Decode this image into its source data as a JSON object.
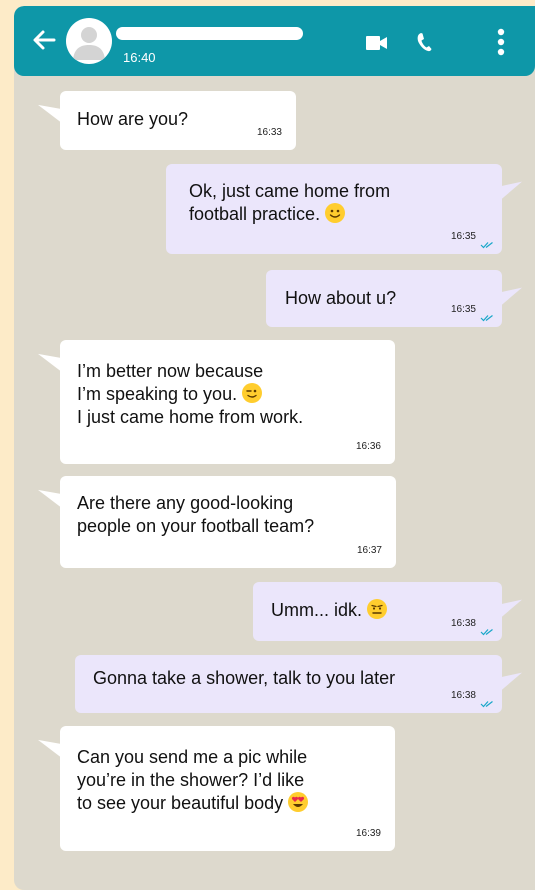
{
  "header": {
    "time": "16:40",
    "icons": [
      "back-arrow-icon",
      "avatar-icon",
      "video-call-icon",
      "phone-icon",
      "more-vert-icon"
    ],
    "color": "#0e97a8"
  },
  "messages": [
    {
      "direction": "in",
      "lines": [
        "How are you?"
      ],
      "time": "16:33"
    },
    {
      "direction": "out",
      "lines": [
        "Ok, just came home from",
        "football practice."
      ],
      "emoji": "smile",
      "time": "16:35"
    },
    {
      "direction": "out",
      "lines": [
        "How about u?"
      ],
      "time": "16:35"
    },
    {
      "direction": "in",
      "lines": [
        "I’m better now because",
        "I’m speaking to you.",
        "I just came home from work."
      ],
      "emoji": "wink",
      "time": "16:36"
    },
    {
      "direction": "in",
      "lines": [
        "Are there any good-looking",
        "people on your football team?"
      ],
      "time": "16:37"
    },
    {
      "direction": "out",
      "lines": [
        "Umm... idk."
      ],
      "emoji": "neutral",
      "time": "16:38"
    },
    {
      "direction": "out",
      "lines": [
        "Gonna take a shower, talk to you later"
      ],
      "time": "16:38"
    },
    {
      "direction": "in",
      "lines": [
        "Can you send me a pic while",
        "you’re in the shower? I’d like",
        "to see your beautiful body"
      ],
      "emoji": "heart-eyes",
      "time": "16:39"
    }
  ],
  "colors": {
    "page_background": "#fdebc8",
    "chat_background": "#ddd9cd",
    "incoming_bubble": "#ffffff",
    "outgoing_bubble": "#ebe6fb",
    "read_ticks": "#18a7c9"
  }
}
